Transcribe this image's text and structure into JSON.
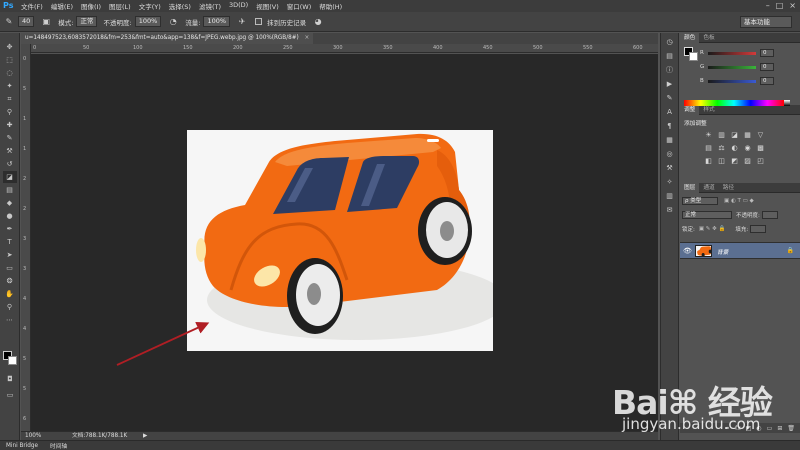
{
  "app": {
    "logo": "Ps",
    "menu": [
      "文件(F)",
      "编辑(E)",
      "图像(I)",
      "图层(L)",
      "文字(Y)",
      "选择(S)",
      "滤镜(T)",
      "3D(D)",
      "视图(V)",
      "窗口(W)",
      "帮助(H)"
    ],
    "window_controls": [
      "–",
      "□",
      "×"
    ]
  },
  "options": {
    "brush_size": "40",
    "mode_label": "模式:",
    "mode_value": "正常",
    "opacity_label": "不透明度:",
    "opacity_value": "100%",
    "flow_label": "流量:",
    "flow_value": "100%",
    "history_label": "抹到历史记录",
    "workspace": "基本功能"
  },
  "document": {
    "tab_title": "u=148497523,6083572018&fm=253&fmt=auto&app=138&f=JPEG.webp.jpg @ 100%(RGB/8#)",
    "tab_close": "×"
  },
  "rulers": {
    "top_ticks": [
      "0",
      "50",
      "100",
      "150",
      "200",
      "250",
      "300",
      "350",
      "400",
      "450",
      "500",
      "550",
      "600",
      "650",
      "700",
      "750"
    ],
    "left_ticks": [
      "0",
      "5",
      "1",
      "1",
      "2",
      "2",
      "3",
      "3",
      "4",
      "4",
      "5",
      "5",
      "6"
    ]
  },
  "status": {
    "zoom": "100%",
    "doc_info": "文档:788.1K/788.1K",
    "arrow": "▶"
  },
  "bottom_tabs": [
    "Mini Bridge",
    "时间轴"
  ],
  "panels": {
    "color_tabs": [
      "颜色",
      "色板"
    ],
    "color_rows": [
      {
        "label": "R",
        "value": "0",
        "color": "#d23a3a"
      },
      {
        "label": "G",
        "value": "0",
        "color": "#3ab43a"
      },
      {
        "label": "B",
        "value": "0",
        "color": "#3a5ad2"
      }
    ],
    "adjust_tabs": [
      "调整",
      "样式"
    ],
    "adjust_title": "添加调整",
    "adjust_icons": [
      "☀",
      "▥",
      "◪",
      "▦",
      "▽",
      "▤",
      "⚖",
      "◐",
      "◉",
      "▩",
      "◧",
      "◫",
      "◩",
      "▨",
      "◰"
    ],
    "layers_tabs": [
      "图层",
      "通道",
      "路径"
    ],
    "layers_kind": "ρ 类型",
    "layers_blend": "正常",
    "layers_opacity_label": "不透明度:",
    "layers_lock_label": "锁定:",
    "layers_fill_label": "填充:",
    "layer_name": "背景",
    "layer_lock": "🔒",
    "footer_icons": [
      "⚭",
      "fx",
      "◩",
      "◐",
      "▭",
      "⊞",
      "🗑"
    ]
  },
  "watermark": {
    "main": "Bai⌘ 经验",
    "url": "jingyan.baidu.com"
  },
  "colors": {
    "car_body": "#f26a12",
    "car_window": "#2d3d63",
    "annotation_arrow": "#b01e24"
  }
}
